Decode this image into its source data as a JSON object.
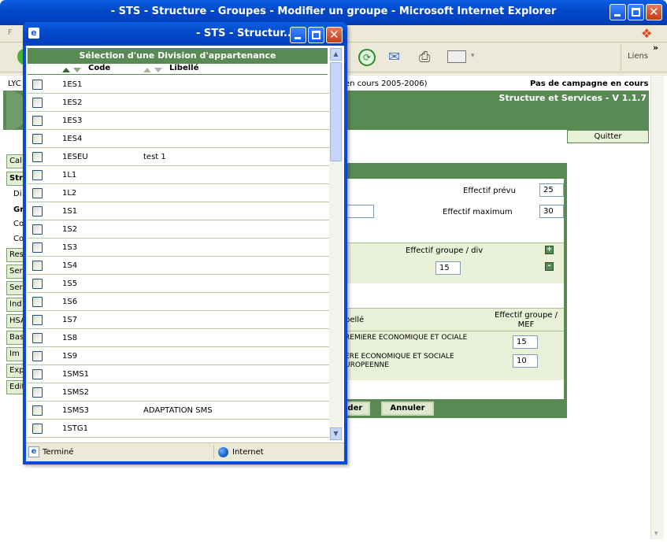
{
  "main_window": {
    "title": "- STS - Structure - Groupes - Modifier un groupe - Microsoft Internet Explorer",
    "menu_first_letter": "F",
    "links_label": "Liens",
    "more_chevron": "»"
  },
  "page": {
    "school_prefix": "LYC",
    "session_text": "en cours 2005-2006)",
    "campaign_text": "Pas de campagne en cours",
    "app_title": "Structure et Services - V 1.1.7",
    "quit_label": "Quitter"
  },
  "sidebar": {
    "buttons": [
      "Cal",
      "Str",
      "Res",
      "Ser",
      "Ser",
      "Ind",
      "HSA",
      "Bas",
      "Im",
      "Exp",
      "Edit"
    ],
    "sub_items": [
      "Di",
      "Gr",
      "Co",
      "Co"
    ]
  },
  "form": {
    "effectif_prevu_label": "Effectif prévu",
    "effectif_prevu_value": "25",
    "effectif_max_label": "Effectif maximum",
    "effectif_max_value": "30",
    "div_header": "Effectif groupe / div",
    "div_value": "15",
    "add_icon": "+",
    "remove_icon": "-",
    "mef_col_libelle": "bellé",
    "mef_col_effectif": "Effectif groupe / MEF",
    "mef_rows": [
      {
        "libelle": "REMIERE ECONOMIQUE ET OCIALE",
        "value": "15"
      },
      {
        "libelle": "ERE ECONOMIQUE ET SOCIALE UROPEENNE",
        "value": "10"
      }
    ],
    "validate_label": "ider",
    "cancel_label": "Annuler"
  },
  "popup": {
    "title": "- STS - Structur...",
    "header": "Sélection d'une Division d'appartenance",
    "col_code": "Code",
    "col_libelle": "Libellé",
    "rows": [
      {
        "code": "1ES1",
        "libelle": ""
      },
      {
        "code": "1ES2",
        "libelle": ""
      },
      {
        "code": "1ES3",
        "libelle": ""
      },
      {
        "code": "1ES4",
        "libelle": ""
      },
      {
        "code": "1ESEU",
        "libelle": "test 1"
      },
      {
        "code": "1L1",
        "libelle": ""
      },
      {
        "code": "1L2",
        "libelle": ""
      },
      {
        "code": "1S1",
        "libelle": ""
      },
      {
        "code": "1S2",
        "libelle": ""
      },
      {
        "code": "1S3",
        "libelle": ""
      },
      {
        "code": "1S4",
        "libelle": ""
      },
      {
        "code": "1S5",
        "libelle": ""
      },
      {
        "code": "1S6",
        "libelle": ""
      },
      {
        "code": "1S7",
        "libelle": ""
      },
      {
        "code": "1S8",
        "libelle": ""
      },
      {
        "code": "1S9",
        "libelle": ""
      },
      {
        "code": "1SMS1",
        "libelle": ""
      },
      {
        "code": "1SMS2",
        "libelle": ""
      },
      {
        "code": "1SMS3",
        "libelle": "ADAPTATION SMS"
      },
      {
        "code": "1STG1",
        "libelle": ""
      }
    ],
    "status_text": "Terminé",
    "zone_text": "Internet"
  }
}
